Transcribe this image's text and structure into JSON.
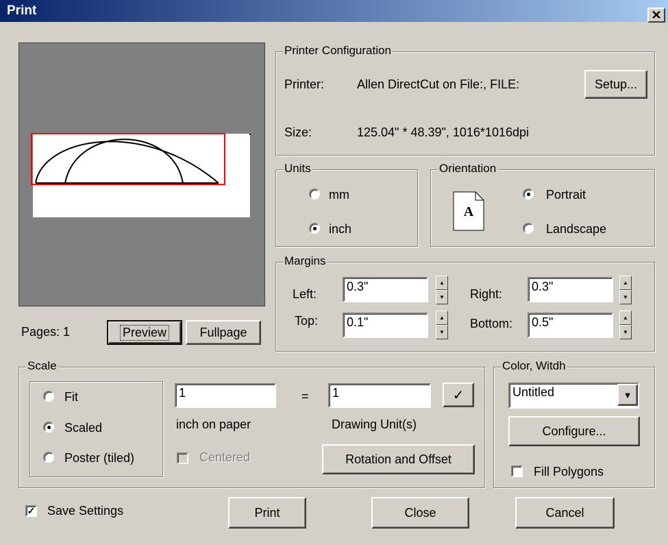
{
  "window": {
    "title": "Print",
    "close_glyph": "✕"
  },
  "preview": {
    "pages_label": "Pages: 1",
    "preview_button": "Preview",
    "fullpage_button": "Fullpage"
  },
  "printer": {
    "group_label": "Printer Configuration",
    "printer_label": "Printer:",
    "printer_value": "Allen DirectCut on File:, FILE:",
    "setup_button": "Setup...",
    "size_label": "Size:",
    "size_value": "125.04\" * 48.39\", 1016*1016dpi"
  },
  "units": {
    "group_label": "Units",
    "mm_label": "mm",
    "inch_label": "inch",
    "selected": "inch"
  },
  "orientation": {
    "group_label": "Orientation",
    "portrait_label": "Portrait",
    "landscape_label": "Landscape",
    "selected": "Portrait",
    "icon_letter": "A"
  },
  "margins": {
    "group_label": "Margins",
    "left_label": "Left:",
    "left_value": "0.3\"",
    "right_label": "Right:",
    "right_value": "0.3\"",
    "top_label": "Top:",
    "top_value": "0.1\"",
    "bottom_label": "Bottom:",
    "bottom_value": "0.5\""
  },
  "scale": {
    "group_label": "Scale",
    "fit_label": "Fit",
    "scaled_label": "Scaled",
    "poster_label": "Poster (tiled)",
    "selected": "Scaled",
    "paper_value": "1",
    "equals": "=",
    "drawing_value": "1",
    "paper_caption": "inch on paper",
    "drawing_caption": "Drawing Unit(s)",
    "centered_label": "Centered",
    "apply_glyph": "✓",
    "rotation_button": "Rotation and Offset"
  },
  "color": {
    "group_label": "Color, Witdh",
    "dropdown_value": "Untitled",
    "configure_button": "Configure...",
    "fill_polygons_label": "Fill Polygons"
  },
  "footer": {
    "save_settings_label": "Save Settings",
    "save_checked": true,
    "print_button": "Print",
    "close_button": "Close",
    "cancel_button": "Cancel"
  }
}
